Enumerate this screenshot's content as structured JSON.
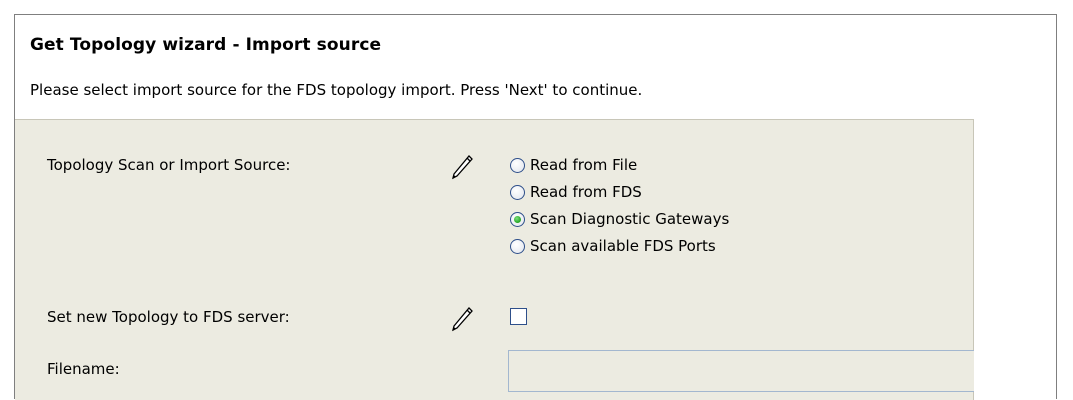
{
  "wizard": {
    "title": "Get Topology wizard - Import source",
    "description": "Please select import source for the FDS topology import. Press 'Next' to continue."
  },
  "form": {
    "source_label": "Topology Scan or Import Source:",
    "source_options": [
      {
        "label": "Read from File",
        "selected": false
      },
      {
        "label": "Read from FDS",
        "selected": false
      },
      {
        "label": "Scan Diagnostic Gateways",
        "selected": true
      },
      {
        "label": "Scan available FDS Ports",
        "selected": false
      }
    ],
    "set_topology_label": "Set new Topology to FDS server:",
    "set_topology_checked": false,
    "filename_label": "Filename:",
    "filename_value": ""
  },
  "icons": {
    "edit": "pencil-icon"
  }
}
